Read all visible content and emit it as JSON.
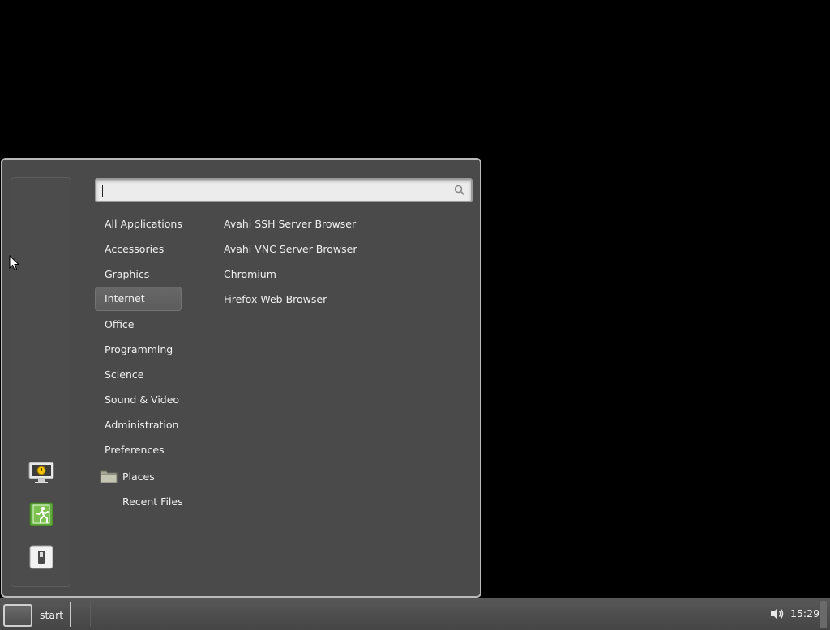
{
  "menu": {
    "search": {
      "placeholder": "",
      "value": ""
    },
    "categories": [
      {
        "label": "All Applications"
      },
      {
        "label": "Accessories"
      },
      {
        "label": "Graphics"
      },
      {
        "label": "Internet",
        "selected": true
      },
      {
        "label": "Office"
      },
      {
        "label": "Programming"
      },
      {
        "label": "Science"
      },
      {
        "label": "Sound & Video"
      },
      {
        "label": "Administration"
      },
      {
        "label": "Preferences"
      }
    ],
    "places": {
      "label": "Places",
      "icon": "folder-icon"
    },
    "recent_files": {
      "label": "Recent Files"
    },
    "applications": [
      {
        "label": "Avahi SSH Server Browser"
      },
      {
        "label": "Avahi VNC Server Browser"
      },
      {
        "label": "Chromium"
      },
      {
        "label": "Firefox Web Browser"
      }
    ],
    "favorites": [
      {
        "icon": "lock-screen-icon"
      },
      {
        "icon": "logout-icon"
      },
      {
        "icon": "shutdown-icon"
      }
    ]
  },
  "taskbar": {
    "start_label": "start",
    "clock": "15:29",
    "tray_icons": [
      "volume-icon"
    ]
  },
  "colors": {
    "menu_bg": "#4a4a4a",
    "menu_border": "#b9b9b9",
    "selected_bg": "#636363",
    "logout_green": "#5fa83a",
    "desktop_bg": "#000000"
  }
}
